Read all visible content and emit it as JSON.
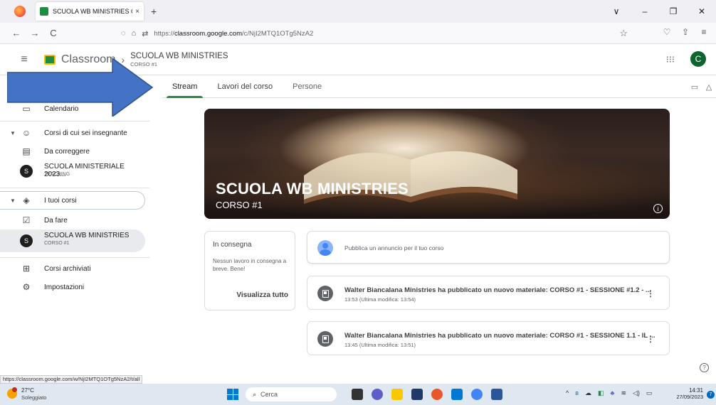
{
  "browser": {
    "tab_title": "SCUOLA WB MINISTRIES CORS",
    "tab_close": "×",
    "new_tab": "+",
    "url_prefix": "https://",
    "url_domain": "classroom.google.com",
    "url_path": "/c/NjI2MTQ1OTg5NzA2",
    "controls": {
      "chevron": "∨",
      "minimize": "–",
      "restore": "❐",
      "close": "✕"
    },
    "nav": {
      "back": "←",
      "forward": "→",
      "reload": "C"
    },
    "icons": {
      "shield": "shield-icon",
      "lock": "lock-icon",
      "permissions": "permissions-icon",
      "star": "star-icon",
      "pocket": "pocket-icon",
      "extensions": "extensions-icon",
      "menu": "menu-icon"
    }
  },
  "header": {
    "brand": "Classroom",
    "course_title": "SCUOLA WB MINISTRIES",
    "course_section": "CORSO #1",
    "avatar_letter": "C",
    "brand_color": "#1e8e3e"
  },
  "course_tabs": [
    {
      "label": "Stream",
      "active": true
    },
    {
      "label": "Lavori del corso",
      "active": false
    },
    {
      "label": "Persone",
      "active": false
    }
  ],
  "sidebar": {
    "calendar": "Calendario",
    "teaching_header": "Corsi di cui sei insegnante",
    "to_review": "Da correggere",
    "teaching_course": {
      "avatar": "S",
      "title": "SCUOLA MINISTERIALE 2023...",
      "sub": "TEACHING"
    },
    "enrolled_header": "I tuoi corsi",
    "todo": "Da fare",
    "enrolled_course": {
      "avatar": "S",
      "title": "SCUOLA WB MINISTRIES",
      "sub": "CORSO #1"
    },
    "archived": "Corsi archiviati",
    "settings": "Impostazioni"
  },
  "banner": {
    "title": "SCUOLA WB MINISTRIES",
    "subtitle": "CORSO #1",
    "info": "i"
  },
  "due_card": {
    "title": "In consegna",
    "text": "Nessun lavoro in consegna a breve. Bene!",
    "link": "Visualizza tutto"
  },
  "post_box": {
    "placeholder": "Pubblica un annuncio per il tuo corso"
  },
  "feed": [
    {
      "title": "Walter Biancalana Ministries ha pubblicato un nuovo materiale: CORSO #1 - SESSIONE #1.2 - ...",
      "time": "13:53 (Ultima modifica: 13:54)"
    },
    {
      "title": "Walter Biancalana Ministries ha pubblicato un nuovo materiale: CORSO #1 - SESSIONE 1.1 - IL ...",
      "time": "13:45 (Ultima modifica: 13:51)"
    }
  ],
  "status_url": "https://classroom.google.com/w/NjI2MTQ1OTg5NzA2/t/all",
  "taskbar": {
    "temp": "27°C",
    "condition": "Soleggiato",
    "search": "Cerca",
    "time": "14:31",
    "date": "27/09/2023",
    "notifications": "7"
  }
}
